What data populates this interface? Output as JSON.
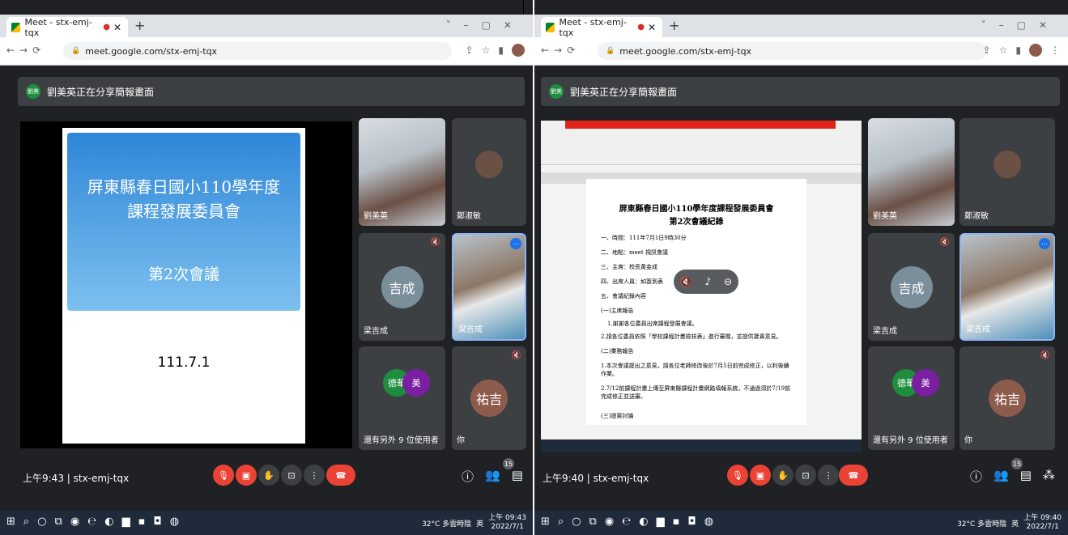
{
  "screens": [
    {
      "tab_title": "Meet - stx-emj-tqx",
      "url": "meet.google.com/stx-emj-tqx",
      "presenter_avatar": "劉美",
      "presenter_banner": "劉美英正在分享簡報畫面",
      "slide": {
        "title_line1": "屏東縣春日國小110學年度",
        "title_line2": "課程發展委員會",
        "subtitle": "第2次會議",
        "date": "111.7.1"
      },
      "tiles": {
        "video1_name": "劉美英",
        "video2_name": "鄭淑敏",
        "avatar_tile_initials": "吉成",
        "avatar_tile_name": "梁吉成",
        "video3_name": "梁吉成",
        "group_av1": "德華",
        "group_av2": "美",
        "group_label": "還有另外 9 位使用者",
        "self_initials": "祐吉",
        "self_name": "你"
      },
      "meeting_time": "上午9:43",
      "meeting_code": "stx-emj-tqx",
      "participants_count": "15",
      "taskbar": {
        "weather": "32°C 多雲時陰",
        "ime": "英",
        "time": "上午 09:43",
        "date": "2022/7/1"
      }
    },
    {
      "tab_title": "Meet - stx-emj-tqx",
      "url": "meet.google.com/stx-emj-tqx",
      "presenter_avatar": "劉美",
      "presenter_banner": "劉美英正在分享簡報畫面",
      "doc": {
        "title": "屏東縣春日國小110學年度課程發展委員會",
        "subtitle": "第2次會議紀錄",
        "line1": "一、時間：111年7月1日9時30分",
        "line2": "二、地點：meet 視訊會議",
        "line3": "三、主席：校長黃金成",
        "line4": "四、出席人員：如簽到表",
        "line5": "五、會議紀錄內容",
        "line6": "(一)主席報告",
        "line7": "1.謝謝各位委員出席課程發展會議。",
        "line8": "2.請各位委員依照「學校課程計畫檢核表」進行審閱，並提供寶貴意見。",
        "line9": "(二)業務報告",
        "line10": "1.本次會議提出之意見，請各位老師修改後於7月5日前完成修正，以利後續作業。",
        "line11": "2.7/12前課程計畫上傳至屏東縣課程計畫網路填報系統，不通過須於7/19前完成修正並送審。",
        "line12": "(三)提案討論"
      },
      "tiles": {
        "video1_name": "劉美英",
        "video2_name": "鄭淑敏",
        "avatar_tile_initials": "吉成",
        "avatar_tile_name": "梁吉成",
        "video3_name": "梁吉成",
        "group_av1": "德華",
        "group_av2": "美",
        "group_label": "還有另外 9 位使用者",
        "self_initials": "祐吉",
        "self_name": "你"
      },
      "meeting_time": "上午9:40",
      "meeting_code": "stx-emj-tqx",
      "participants_count": "15",
      "taskbar": {
        "weather": "32°C 多雲時陰",
        "ime": "英",
        "time": "上午 09:40",
        "date": "2022/7/1"
      }
    }
  ],
  "colors": {
    "meet_bg": "#202124",
    "tile_bg": "#3c4043",
    "mic_off_red": "#ea4335",
    "accent_blue": "#1a73e8"
  },
  "icons": [
    "meet-favicon",
    "recording-dot-icon",
    "close-icon",
    "new-tab-icon",
    "back-icon",
    "forward-icon",
    "reload-icon",
    "lock-icon",
    "share-icon",
    "bookmark-star-icon",
    "sidebar-icon",
    "mic-off-icon",
    "camera-off-icon",
    "raise-hand-icon",
    "present-icon",
    "more-icon",
    "hangup-icon",
    "info-icon",
    "people-icon",
    "chat-icon",
    "activities-icon",
    "windows-start-icon",
    "search-icon"
  ]
}
